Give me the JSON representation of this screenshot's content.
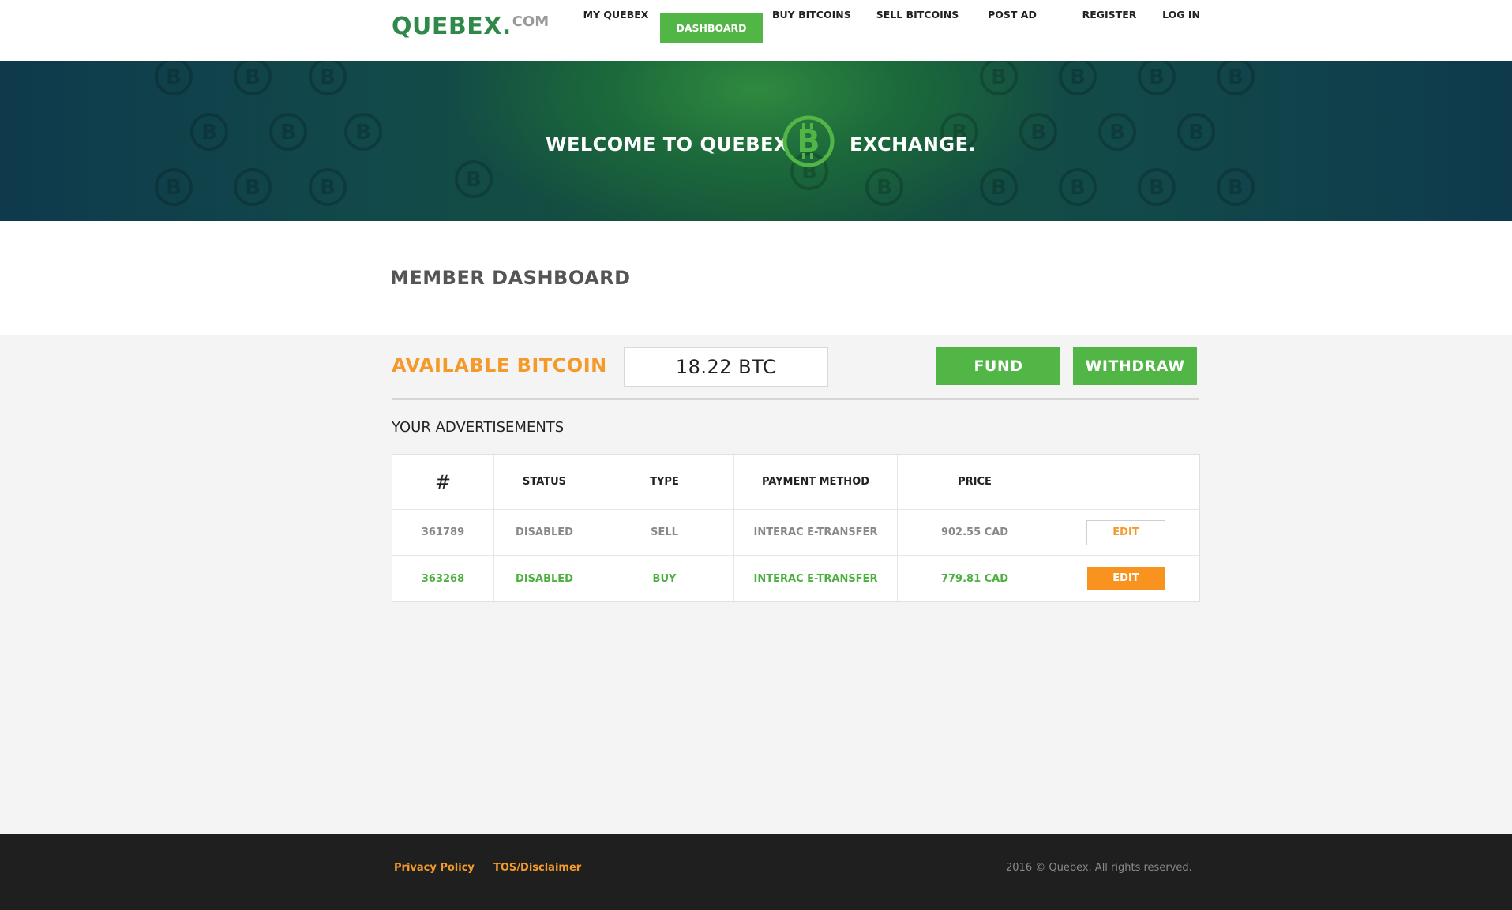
{
  "brand": {
    "name": "QUEBEX.",
    "suffix": "COM"
  },
  "nav": {
    "items": [
      {
        "label": "MY QUEBEX"
      },
      {
        "label": "DASHBOARD",
        "active": true
      },
      {
        "label": "BUY BITCOINS"
      },
      {
        "label": "SELL BITCOINS"
      },
      {
        "label": "POST AD"
      },
      {
        "label": "REGISTER"
      },
      {
        "label": "LOG IN"
      }
    ]
  },
  "banner": {
    "welcome": "WELCOME TO QUEBEX",
    "exchange": "EXCHANGE.",
    "icon": "bitcoin-icon"
  },
  "page": {
    "title": "MEMBER DASHBOARD"
  },
  "balance": {
    "label": "AVAILABLE BITCOIN",
    "value": "18.22 BTC",
    "fund_label": "FUND",
    "withdraw_label": "WITHDRAW"
  },
  "ads": {
    "title": "YOUR ADVERTISEMENTS",
    "columns": [
      "#",
      "STATUS",
      "TYPE",
      "PAYMENT METHOD",
      "PRICE",
      ""
    ],
    "rows": [
      {
        "id": "361789",
        "status": "DISABLED",
        "type": "SELL",
        "payment": "INTERAC E-TRANSFER",
        "price": "902.55 CAD",
        "action": "EDIT"
      },
      {
        "id": "363268",
        "status": "DISABLED",
        "type": "BUY",
        "payment": "INTERAC E-TRANSFER",
        "price": "779.81 CAD",
        "action": "EDIT"
      }
    ]
  },
  "footer": {
    "privacy": "Privacy Policy",
    "tos": "TOS/Disclaimer",
    "copyright": "2016 © Quebex. All rights reserved."
  },
  "colors": {
    "accent_green": "#52b646",
    "brand_green": "#2f8a4a",
    "accent_orange": "#f39a2b",
    "footer_bg": "#1f1f1f"
  }
}
